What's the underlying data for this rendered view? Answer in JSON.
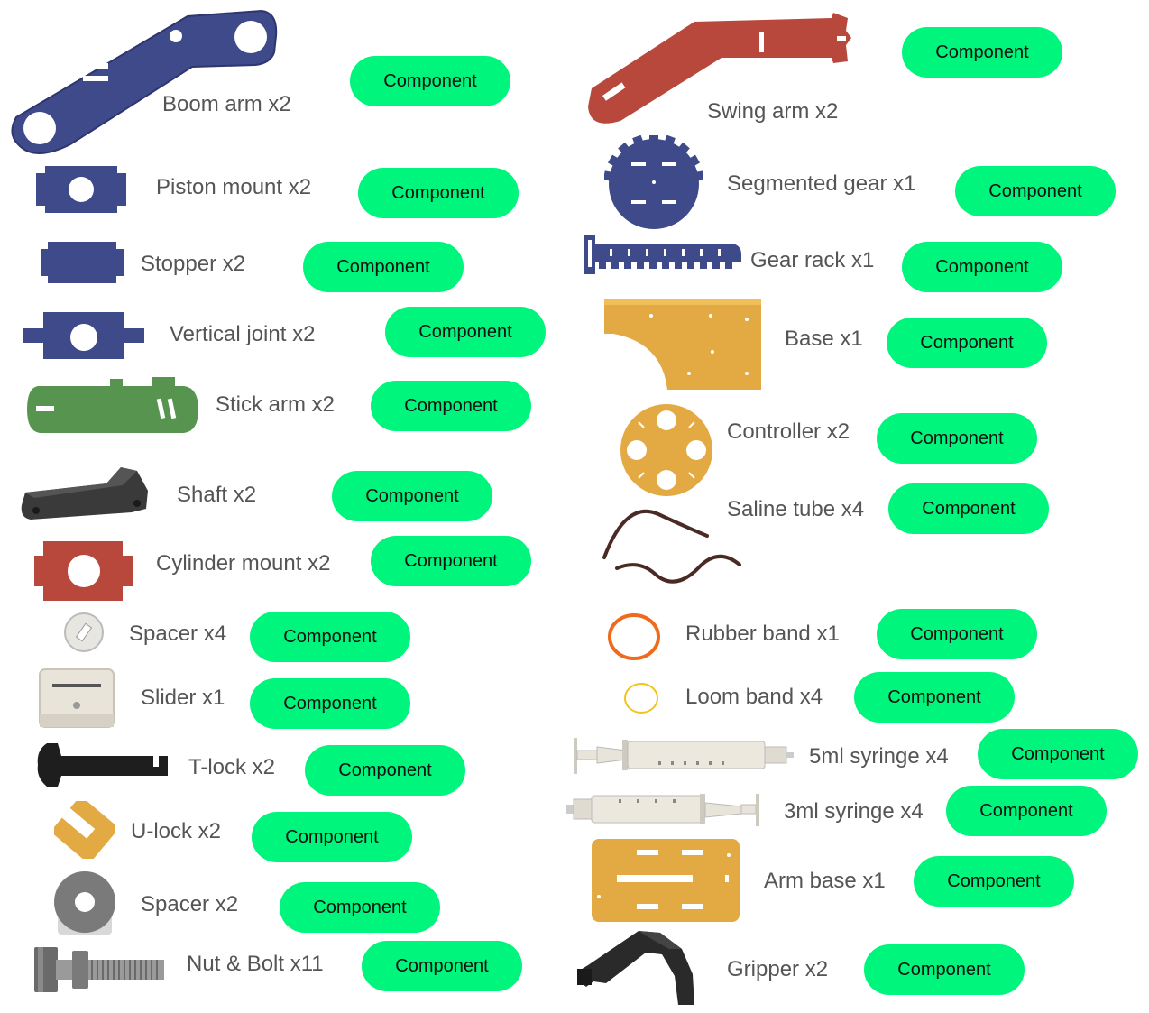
{
  "button_label": "Component",
  "colors": {
    "button": "#00f57c",
    "navy": "#3f4a8a",
    "red": "#b8483c",
    "green": "#56944f",
    "orange": "#e3a942",
    "black": "#2a2a2a",
    "label": "#555555"
  },
  "parts": [
    {
      "label": "Boom arm  x2",
      "icon": "boom-arm-icon"
    },
    {
      "label": "Piston mount  x2",
      "icon": "piston-mount-icon"
    },
    {
      "label": "Stopper  x2",
      "icon": "stopper-icon"
    },
    {
      "label": "Vertical joint  x2",
      "icon": "vertical-joint-icon"
    },
    {
      "label": "Stick arm x2",
      "icon": "stick-arm-icon"
    },
    {
      "label": "Shaft x2",
      "icon": "shaft-icon"
    },
    {
      "label": "Cylinder mount  x2",
      "icon": "cylinder-mount-icon"
    },
    {
      "label": "Spacer x4",
      "icon": "spacer-washer-icon"
    },
    {
      "label": "Slider x1",
      "icon": "slider-icon"
    },
    {
      "label": "T-lock  x2",
      "icon": "t-lock-icon"
    },
    {
      "label": "U-lock  x2",
      "icon": "u-lock-icon"
    },
    {
      "label": "Spacer  x2",
      "icon": "spacer-icon"
    },
    {
      "label": "Nut & Bolt  x11",
      "icon": "nut-bolt-icon"
    },
    {
      "label": "Swing arm  x2",
      "icon": "swing-arm-icon"
    },
    {
      "label": "Segmented gear x1",
      "icon": "segmented-gear-icon"
    },
    {
      "label": "Gear rack x1",
      "icon": "gear-rack-icon"
    },
    {
      "label": "Base x1",
      "icon": "base-icon"
    },
    {
      "label": "Controller x2",
      "icon": "controller-icon"
    },
    {
      "label": "Saline tube x4",
      "icon": "saline-tube-icon"
    },
    {
      "label": "Rubber band x1",
      "icon": "rubber-band-icon"
    },
    {
      "label": "Loom band x4",
      "icon": "loom-band-icon"
    },
    {
      "label": "5ml syringe x4",
      "icon": "syringe-5ml-icon"
    },
    {
      "label": "3ml syringe x4",
      "icon": "syringe-3ml-icon"
    },
    {
      "label": "Arm base x1",
      "icon": "arm-base-icon"
    },
    {
      "label": "Gripper x2",
      "icon": "gripper-icon"
    }
  ]
}
